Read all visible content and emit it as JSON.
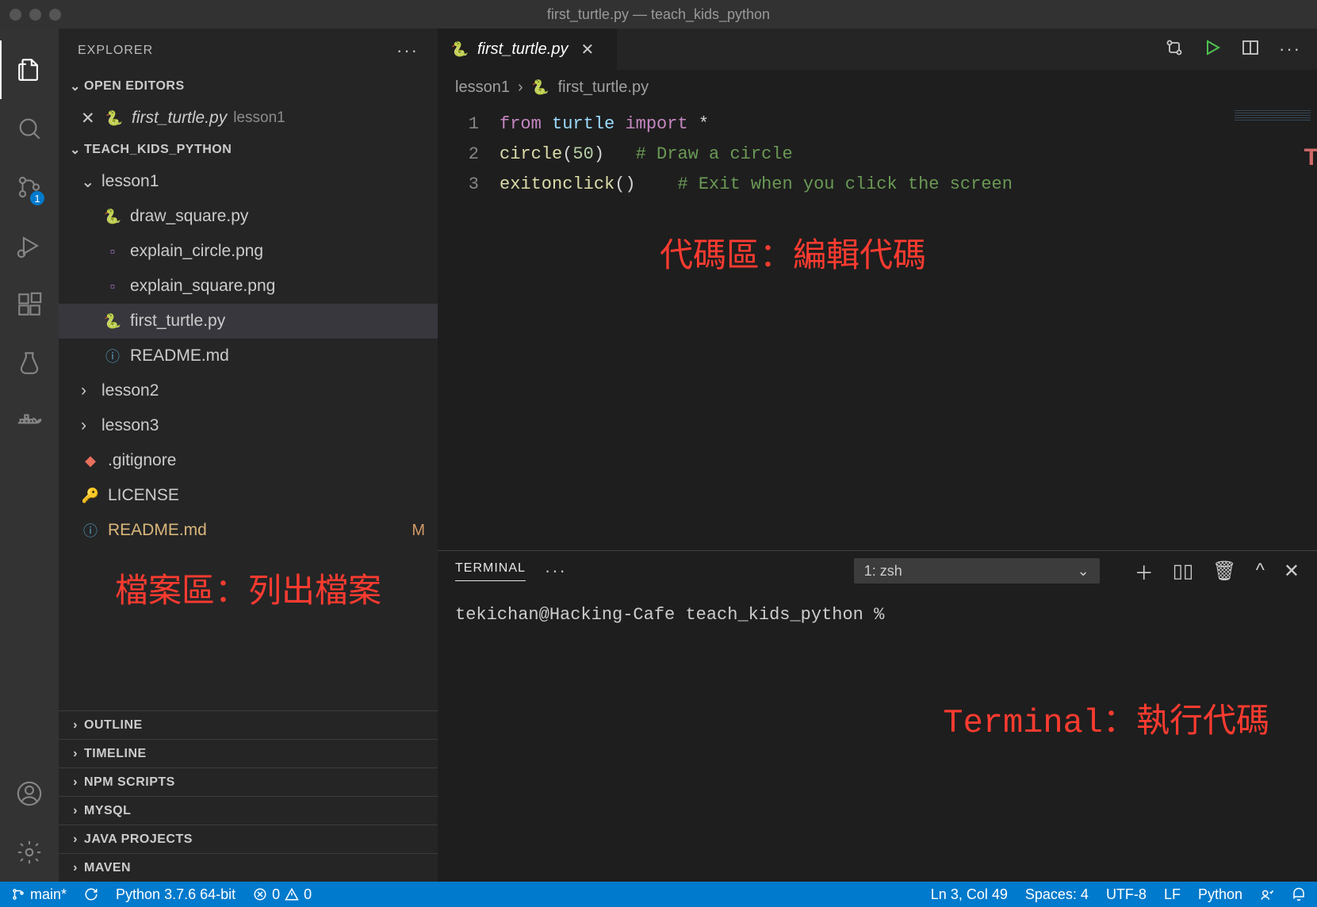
{
  "window": {
    "title": "first_turtle.py — teach_kids_python"
  },
  "activitybar": {
    "scm_badge": "1"
  },
  "explorer": {
    "title": "EXPLORER",
    "open_editors_label": "OPEN EDITORS",
    "open_editor": {
      "name": "first_turtle.py",
      "folder": "lesson1"
    },
    "workspace_label": "TEACH_KIDS_PYTHON",
    "tree": {
      "lesson1": {
        "label": "lesson1",
        "files": [
          {
            "name": "draw_square.py",
            "icon": "py"
          },
          {
            "name": "explain_circle.png",
            "icon": "img"
          },
          {
            "name": "explain_square.png",
            "icon": "img"
          },
          {
            "name": "first_turtle.py",
            "icon": "py",
            "selected": true
          },
          {
            "name": "README.md",
            "icon": "md"
          }
        ]
      },
      "lesson2": {
        "label": "lesson2"
      },
      "lesson3": {
        "label": "lesson3"
      },
      "root_files": [
        {
          "name": ".gitignore",
          "icon": "git"
        },
        {
          "name": "LICENSE",
          "icon": "lic"
        },
        {
          "name": "README.md",
          "icon": "md",
          "status": "M",
          "modified": true
        }
      ]
    },
    "annotation": "檔案區：列出檔案",
    "outline_sections": [
      "OUTLINE",
      "TIMELINE",
      "NPM SCRIPTS",
      "MYSQL",
      "JAVA PROJECTS",
      "MAVEN"
    ]
  },
  "editor": {
    "tab": {
      "name": "first_turtle.py"
    },
    "breadcrumb": {
      "folder": "lesson1",
      "file": "first_turtle.py"
    },
    "lines": [
      "1",
      "2",
      "3"
    ],
    "code": {
      "l1": {
        "kw1": "from",
        "mod": "turtle",
        "kw2": "import",
        "star": "*"
      },
      "l2": {
        "fn": "circle",
        "lp": "(",
        "num": "50",
        "rp": ")",
        "comment": "# Draw a circle"
      },
      "l3": {
        "fn": "exitonclick",
        "paren": "()",
        "comment": "# Exit when you click the screen"
      }
    },
    "annotation": "代碼區：編輯代碼"
  },
  "terminal": {
    "tab_label": "TERMINAL",
    "shell_selector": "1: zsh",
    "prompt": "tekichan@Hacking-Cafe teach_kids_python %",
    "annotation": "Terminal：執行代碼"
  },
  "statusbar": {
    "branch": "main*",
    "interpreter": "Python 3.7.6 64-bit",
    "errors": "0",
    "warnings": "0",
    "cursor": "Ln 3, Col 49",
    "indent": "Spaces: 4",
    "encoding": "UTF-8",
    "eol": "LF",
    "language": "Python"
  }
}
